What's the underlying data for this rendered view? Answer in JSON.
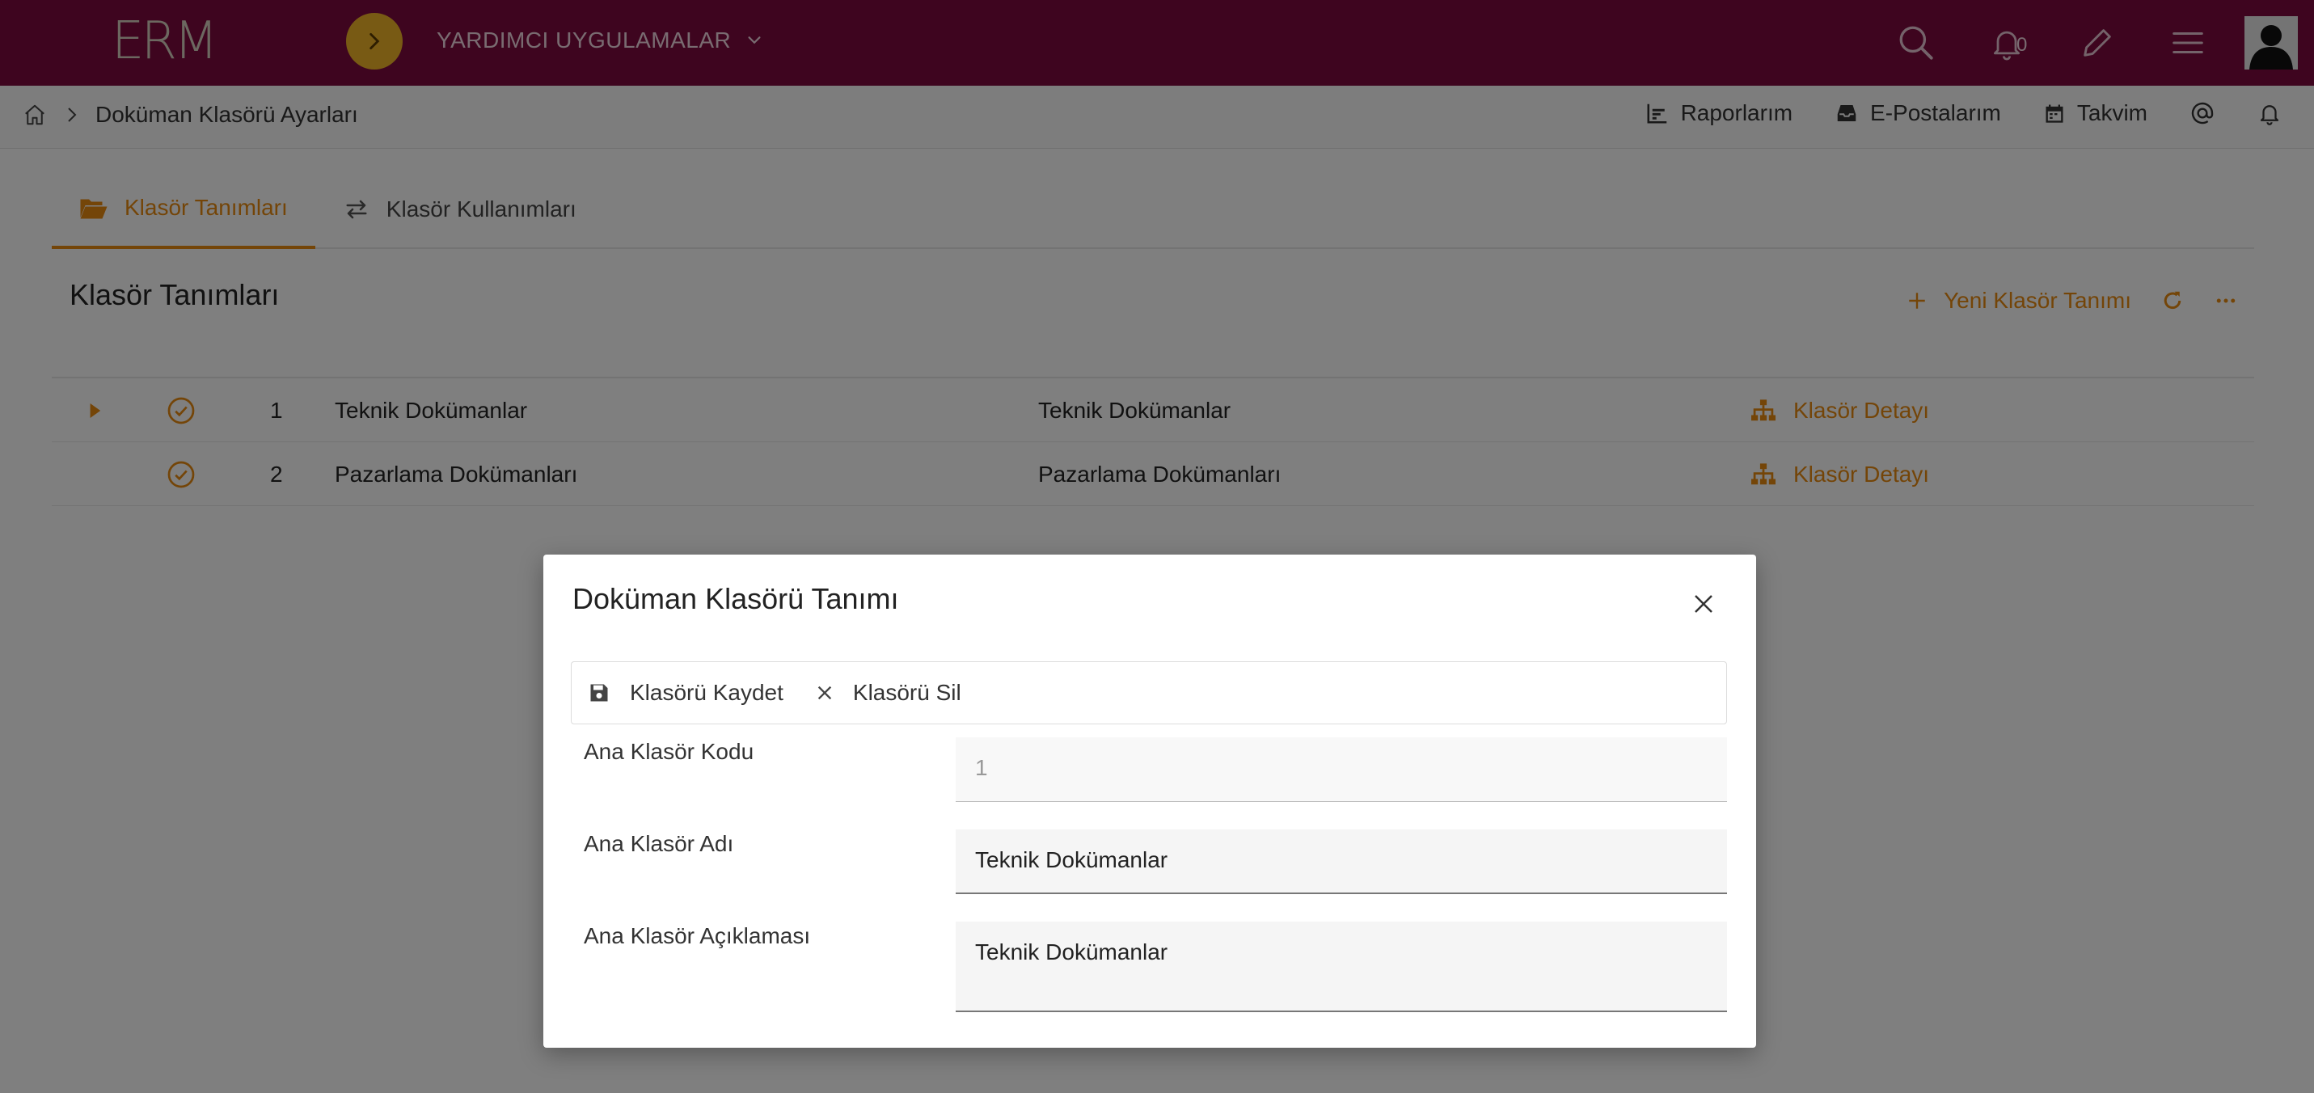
{
  "app": {
    "logo": "ERM",
    "apps_menu_label": "YARDIMCI UYGULAMALAR",
    "notification_count": "0"
  },
  "breadcrumb": {
    "current": "Doküman Klasörü Ayarları"
  },
  "quick_links": [
    {
      "label": "Raporlarım",
      "icon": "chart-icon"
    },
    {
      "label": "E-Postalarım",
      "icon": "inbox-icon"
    },
    {
      "label": "Takvim",
      "icon": "calendar-icon"
    }
  ],
  "tabs": [
    {
      "label": "Klasör Tanımları",
      "active": true,
      "icon": "folder-open-icon"
    },
    {
      "label": "Klasör Kullanımları",
      "active": false,
      "icon": "exchange-icon"
    }
  ],
  "section": {
    "title": "Klasör Tanımları",
    "new_button": "Yeni Klasör Tanımı"
  },
  "rows": [
    {
      "no": "1",
      "name": "Teknik Dokümanlar",
      "description": "Teknik Dokümanlar",
      "detail": "Klasör Detayı"
    },
    {
      "no": "2",
      "name": "Pazarlama Dokümanları",
      "description": "Pazarlama Dokümanları",
      "detail": "Klasör Detayı"
    }
  ],
  "modal": {
    "title": "Doküman Klasörü Tanımı",
    "save_label": "Klasörü Kaydet",
    "delete_label": "Klasörü Sil",
    "fields": [
      {
        "label": "Ana Klasör Kodu",
        "value": "1"
      },
      {
        "label": "Ana Klasör Adı",
        "value": "Teknik Dokümanlar"
      },
      {
        "label": "Ana Klasör Açıklaması",
        "value": "Teknik Dokümanlar"
      }
    ]
  },
  "colors": {
    "topbar": "#7c0a3f",
    "accent": "#e88a10",
    "toggle": "#f0b429"
  }
}
